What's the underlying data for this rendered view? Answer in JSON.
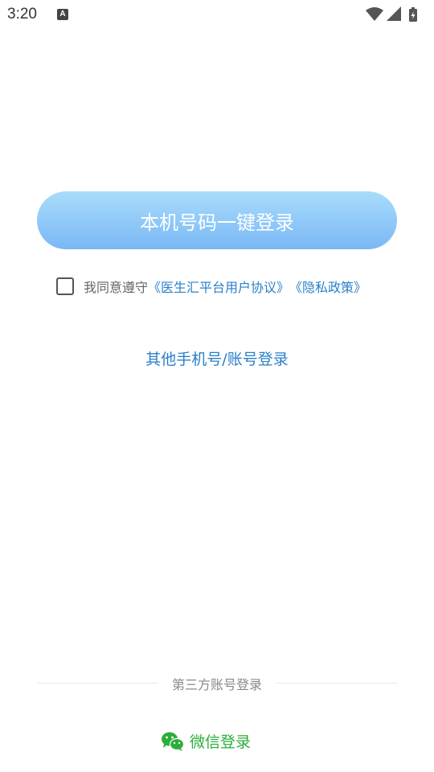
{
  "status_bar": {
    "time": "3:20",
    "app_icon_letter": "A"
  },
  "main": {
    "one_click_login_label": "本机号码一键登录",
    "agreement_prefix": "我同意遵守",
    "agreement_user_link": "《医生汇平台用户协议》",
    "agreement_privacy_link": "《隐私政策》",
    "other_login_label": "其他手机号/账号登录"
  },
  "third_party": {
    "divider_label": "第三方账号登录",
    "wechat_label": "微信登录"
  },
  "colors": {
    "button_gradient_top": "#a9dcfb",
    "button_gradient_bottom": "#7ab8f5",
    "link_blue": "#2a80c8",
    "wechat_green": "#2aae3a"
  },
  "icons": {
    "wifi": "wifi-icon",
    "signal": "signal-icon",
    "battery": "battery-charging-icon",
    "wechat": "wechat-icon",
    "app_notice": "app-notice-icon"
  }
}
